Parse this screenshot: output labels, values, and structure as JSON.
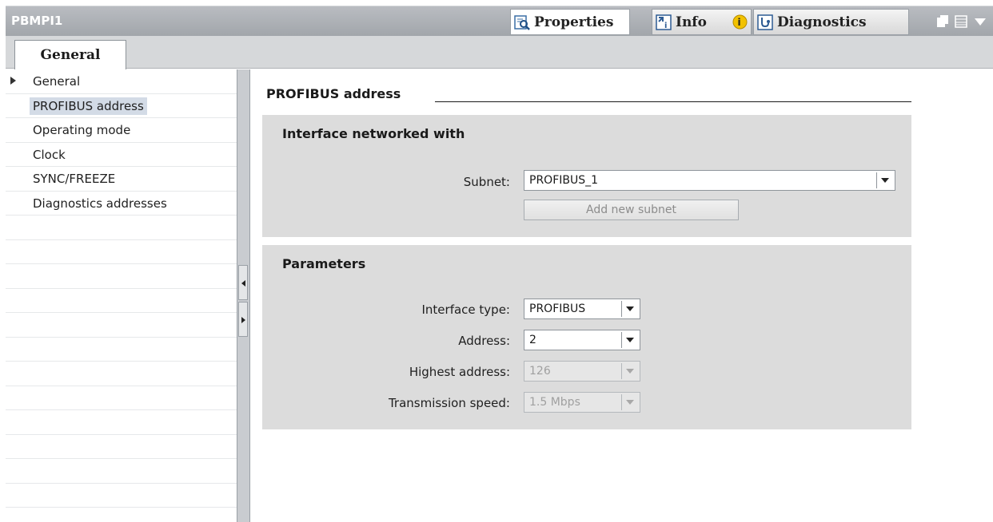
{
  "window": {
    "title": "PBMPI1"
  },
  "top_tabs": [
    {
      "label": "Properties",
      "icon": "properties-icon",
      "active": true
    },
    {
      "label": "Info",
      "icon": "info-icon"
    },
    {
      "label": "Diagnostics",
      "icon": "diagnostics-icon"
    }
  ],
  "tab_strip": {
    "general": "General"
  },
  "nav": {
    "items": [
      {
        "label": "General",
        "expandable": true
      },
      {
        "label": "PROFIBUS address",
        "selected": true
      },
      {
        "label": "Operating mode"
      },
      {
        "label": "Clock"
      },
      {
        "label": "SYNC/FREEZE"
      },
      {
        "label": "Diagnostics addresses"
      }
    ]
  },
  "content": {
    "section_title": "PROFIBUS address",
    "interface_group": {
      "title": "Interface networked with",
      "subnet_label": "Subnet:",
      "subnet_value": "PROFIBUS_1",
      "add_subnet_button": "Add new subnet"
    },
    "parameters_group": {
      "title": "Parameters",
      "interface_type_label": "Interface type:",
      "interface_type_value": "PROFIBUS",
      "address_label": "Address:",
      "address_value": "2",
      "highest_address_label": "Highest address:",
      "highest_address_value": "126",
      "transmission_speed_label": "Transmission speed:",
      "transmission_speed_value": "1.5 Mbps"
    }
  },
  "colors": {
    "title_bar": "#a9adb2",
    "selected_nav": "#d3dbe6",
    "group_background": "#dcdcdc",
    "info_badge": "#f2c200"
  }
}
